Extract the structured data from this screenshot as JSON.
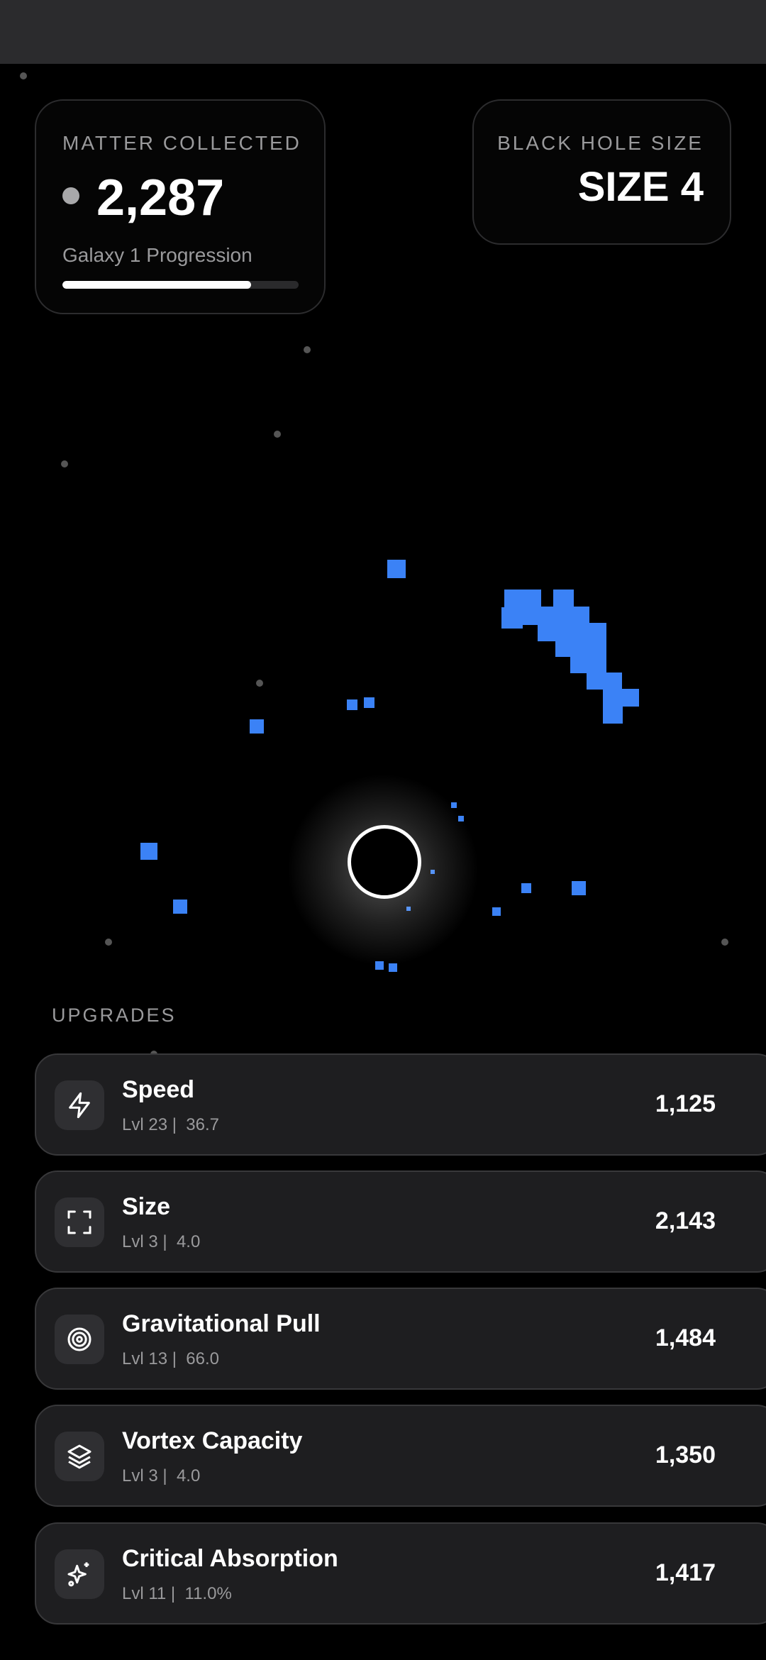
{
  "hud": {
    "matter_label": "MATTER COLLECTED",
    "matter_value": "2,287",
    "progression_label": "Galaxy 1 Progression",
    "progression_fraction": 0.8,
    "size_label": "BLACK HOLE SIZE",
    "size_value": "SIZE 4"
  },
  "colors": {
    "matter": "#3b82f6",
    "panel_border": "#2c2c2e",
    "card_bg": "#1e1e20"
  },
  "upgrades": {
    "title": "UPGRADES",
    "items": [
      {
        "icon": "lightning-icon",
        "name": "Speed",
        "level": "Lvl 23 |",
        "value": "36.7",
        "cost": "1,125"
      },
      {
        "icon": "expand-icon",
        "name": "Size",
        "level": "Lvl 3 |",
        "value": "4.0",
        "cost": "2,143"
      },
      {
        "icon": "target-icon",
        "name": "Gravitational Pull",
        "level": "Lvl 13 |",
        "value": "66.0",
        "cost": "1,484"
      },
      {
        "icon": "layers-icon",
        "name": "Vortex Capacity",
        "level": "Lvl 3 |",
        "value": "4.0",
        "cost": "1,350"
      },
      {
        "icon": "sparkles-icon",
        "name": "Critical Absorption",
        "level": "Lvl 11 |",
        "value": "11.0%",
        "cost": "1,417"
      }
    ]
  }
}
